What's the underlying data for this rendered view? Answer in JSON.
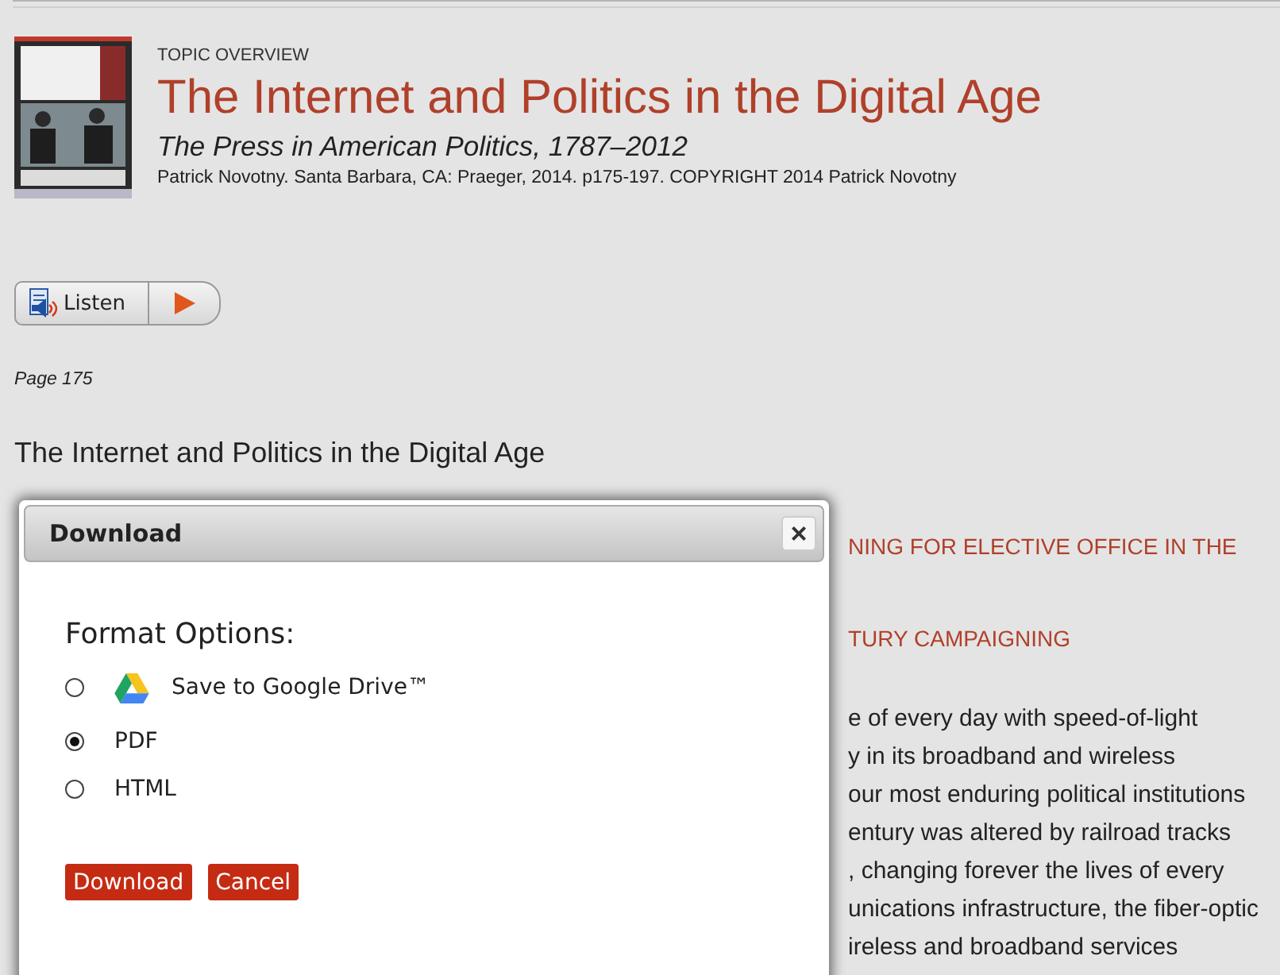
{
  "header": {
    "eyebrow": "TOPIC OVERVIEW",
    "title": "The Internet and Politics in the Digital Age",
    "book": "The Press in American Politics, 1787–2012",
    "citation": "Patrick Novotny. Santa Barbara, CA: Praeger, 2014. p175-197. COPYRIGHT 2014 Patrick Novotny"
  },
  "listen": {
    "label": "Listen"
  },
  "page_label": "Page 175",
  "article": {
    "heading": "The Internet and Politics in the Digital Age",
    "fragments": [
      {
        "kind": "subhead",
        "text": "NING FOR ELECTIVE OFFICE IN THE"
      },
      {
        "kind": "subhead",
        "text": "TURY CAMPAIGNING"
      },
      {
        "kind": "line",
        "text": "e of every day with speed-of-light"
      },
      {
        "kind": "line",
        "text": "y in its broadband and wireless"
      },
      {
        "kind": "line",
        "text": "our most enduring political institutions"
      },
      {
        "kind": "line",
        "text": "entury was altered by railroad tracks"
      },
      {
        "kind": "line",
        "text": ", changing forever the lives of every"
      },
      {
        "kind": "line",
        "text": "unications infrastructure, the fiber-optic"
      },
      {
        "kind": "line",
        "text": "ireless and broadband services"
      }
    ]
  },
  "dialog": {
    "title": "Download",
    "close": "×",
    "heading": "Format Options:",
    "options": [
      {
        "label": "Save to Google Drive™",
        "kind": "drive",
        "selected": false
      },
      {
        "label": "PDF",
        "kind": "plain",
        "selected": true
      },
      {
        "label": "HTML",
        "kind": "plain",
        "selected": false
      }
    ],
    "buttons": [
      "Download",
      "Cancel"
    ]
  }
}
